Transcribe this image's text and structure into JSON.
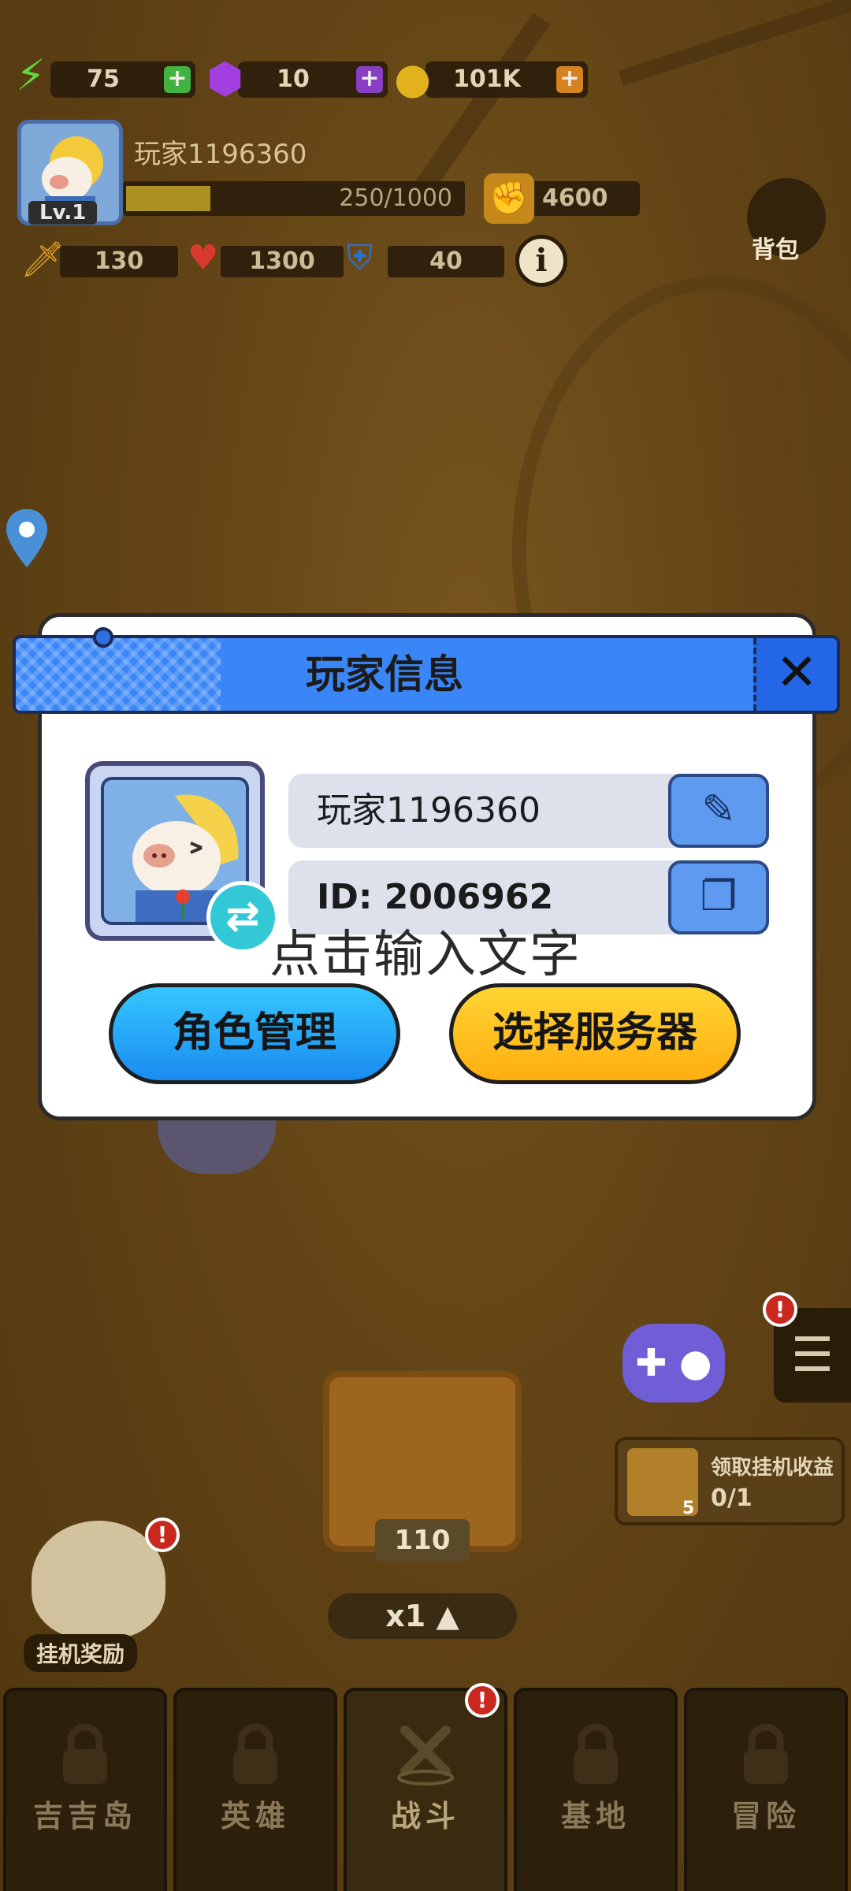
{
  "resources": {
    "energy": {
      "value": "75",
      "icon": "lightning-icon"
    },
    "gems": {
      "value": "10",
      "icon": "gem-icon"
    },
    "coins": {
      "value": "101K",
      "icon": "coin-icon"
    }
  },
  "player": {
    "name": "玩家1196360",
    "level": "Lv.1",
    "xp_text": "250/1000",
    "xp_fraction": 0.25,
    "power": "4600"
  },
  "stats": {
    "attack": "130",
    "hp": "1300",
    "defense": "40"
  },
  "bag_label": "背包",
  "modal": {
    "title": "玩家信息",
    "name_value": "玩家1196360",
    "id_value": "ID: 2006962",
    "overlay_text": "点击输入文字",
    "role_button": "角色管理",
    "server_button": "选择服务器"
  },
  "scene": {
    "chest_count": "110",
    "speed": "x1 ▲",
    "idle_title": "领取挂机收益",
    "idle_count": "0/1",
    "idle_badge": "5",
    "idle_reward_label": "挂机奖励"
  },
  "nav": [
    {
      "label": "吉吉岛"
    },
    {
      "label": "英雄"
    },
    {
      "label": "战斗"
    },
    {
      "label": "基地"
    },
    {
      "label": "冒险"
    }
  ],
  "colors": {
    "header_blue": "#3b86f7",
    "role_button": "#1a8cf0",
    "server_button": "#ffae10"
  }
}
